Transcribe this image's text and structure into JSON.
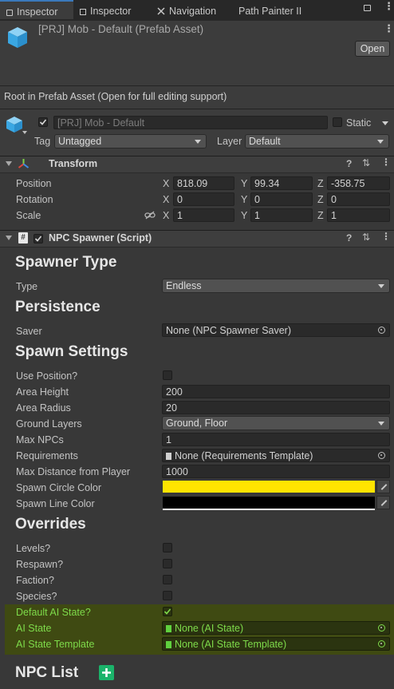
{
  "tabs": [
    {
      "label": "Inspector"
    },
    {
      "label": "Inspector"
    },
    {
      "label": "Navigation"
    },
    {
      "label": "Path Painter II"
    }
  ],
  "header": {
    "title": "[PRJ] Mob - Default (Prefab Asset)",
    "open_label": "Open"
  },
  "root_message": "Root in Prefab Asset (Open for full editing support)",
  "gameobject": {
    "name": "[PRJ] Mob - Default",
    "static_label": "Static",
    "tag_label": "Tag",
    "tag_value": "Untagged",
    "layer_label": "Layer",
    "layer_value": "Default"
  },
  "transform": {
    "title": "Transform",
    "position_label": "Position",
    "rotation_label": "Rotation",
    "scale_label": "Scale",
    "axis_x": "X",
    "axis_y": "Y",
    "axis_z": "Z",
    "position": {
      "x": "818.09",
      "y": "99.34",
      "z": "-358.75"
    },
    "rotation": {
      "x": "0",
      "y": "0",
      "z": "0"
    },
    "scale": {
      "x": "1",
      "y": "1",
      "z": "1"
    }
  },
  "npc_spawner": {
    "title": "NPC Spawner (Script)",
    "spawner_type_heading": "Spawner Type",
    "type_label": "Type",
    "type_value": "Endless",
    "persistence_heading": "Persistence",
    "saver_label": "Saver",
    "saver_value": "None (NPC Spawner Saver)",
    "spawn_settings_heading": "Spawn Settings",
    "use_position_label": "Use Position?",
    "area_height_label": "Area Height",
    "area_height_value": "200",
    "area_radius_label": "Area Radius",
    "area_radius_value": "20",
    "ground_layers_label": "Ground Layers",
    "ground_layers_value": "Ground, Floor",
    "max_npcs_label": "Max NPCs",
    "max_npcs_value": "1",
    "requirements_label": "Requirements",
    "requirements_value": "None (Requirements Template)",
    "max_distance_label": "Max Distance from Player",
    "max_distance_value": "1000",
    "spawn_circle_color_label": "Spawn Circle Color",
    "spawn_circle_color": "#ffe400",
    "spawn_line_color_label": "Spawn Line Color",
    "spawn_line_color": "#000000",
    "overrides_heading": "Overrides",
    "levels_label": "Levels?",
    "respawn_label": "Respawn?",
    "faction_label": "Faction?",
    "species_label": "Species?",
    "default_ai_state_label": "Default AI State?",
    "ai_state_label": "AI State",
    "ai_state_value": "None (AI State)",
    "ai_state_template_label": "AI State Template",
    "ai_state_template_value": "None (AI State Template)",
    "npc_list_heading": "NPC List"
  }
}
